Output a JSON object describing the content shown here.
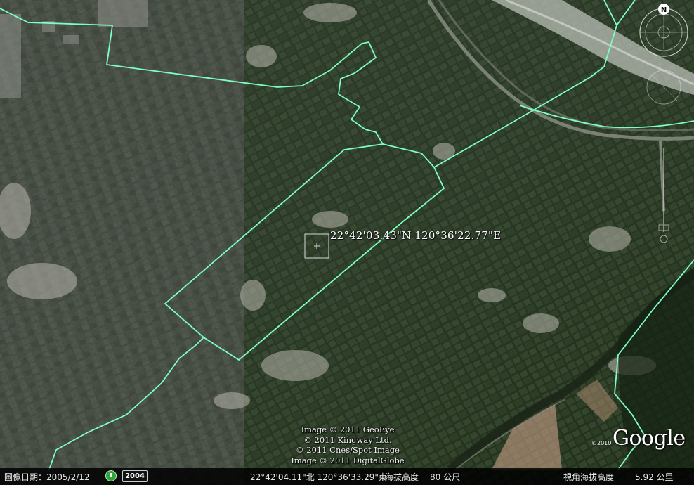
{
  "map": {
    "coordinate_label": "22°42'03.43\"N 120°36'22.77\"E",
    "credits": [
      "Image © 2011 GeoEye",
      "© 2011 Kingway Ltd.",
      "© 2011 Cnes/Spot Image",
      "Image © 2011 DigitalGlobe"
    ],
    "logo_text": "Google",
    "logo_year": "©2010",
    "compass_letter": "N"
  },
  "statusbar": {
    "imagery_date": "圖像日期：2005/2/12",
    "historical_year": "2004",
    "pointer_coordinates": "22°42'04.11\"北 120°36'33.29\"東",
    "elevation_label": "海拔高度",
    "elevation_value": "80 公尺",
    "eye_altitude_label": "視角海拔高度",
    "eye_altitude_value": "5.92 公里"
  },
  "colors": {
    "boundary_line": "#7dffc4",
    "statusbar_bg": "#000000",
    "terrain_dark": "#2c3a29",
    "riverbed": "#b9bdb6"
  }
}
